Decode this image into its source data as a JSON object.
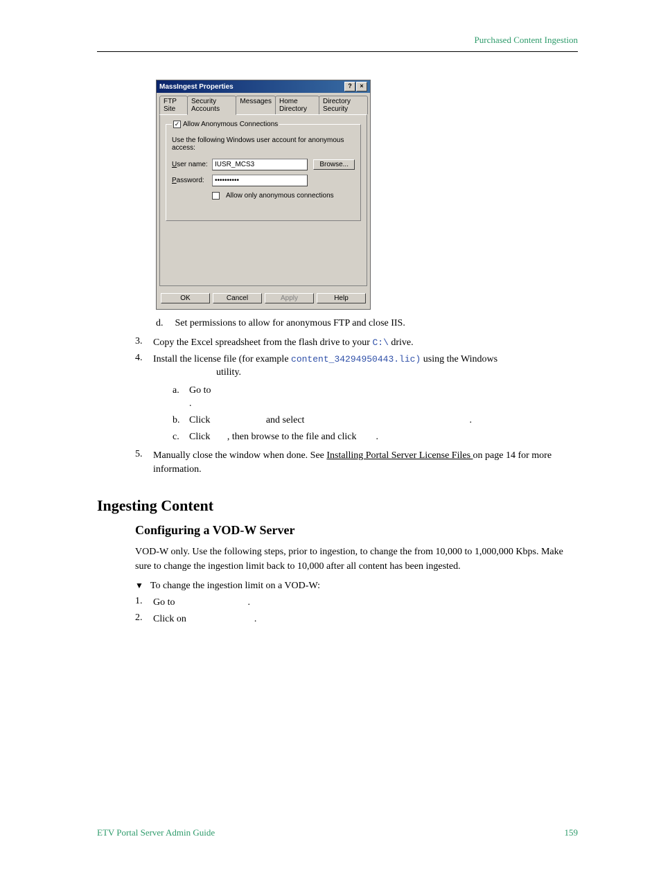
{
  "header": "Purchased Content Ingestion",
  "dialog": {
    "title": "MassIngest Properties",
    "tabs": [
      "FTP Site",
      "Security Accounts",
      "Messages",
      "Home Directory",
      "Directory Security"
    ],
    "activeTab": 1,
    "allowAnon": "Allow Anonymous Connections",
    "note": "Use the following Windows user account for anonymous access:",
    "usernameLabel": "User name:",
    "username": "IUSR_MCS3",
    "passwordLabel": "Password:",
    "password": "••••••••••",
    "browse": "Browse...",
    "allowOnly": "Allow only anonymous connections",
    "buttons": {
      "ok": "OK",
      "cancel": "Cancel",
      "apply": "Apply",
      "help": "Help"
    }
  },
  "stepD": {
    "label": "d.",
    "text": "Set permissions to allow for anonymous FTP and close IIS."
  },
  "step3": {
    "num": "3.",
    "pre": "Copy the Excel spreadsheet from the flash drive to your ",
    "code": "C:\\",
    "post": " drive."
  },
  "step4": {
    "num": "4.",
    "pre": "Install the license file (for example ",
    "code": "content_34294950443.lic)",
    "post": " using the Windows ",
    "tail": "utility.",
    "a": {
      "label": "a.",
      "text": "Go to ",
      "suffix": "."
    },
    "b": {
      "label": "b.",
      "pre": "Click ",
      "mid": " and select ",
      "post": "."
    },
    "c": {
      "label": "c.",
      "pre": "Click ",
      "mid": ", then browse to the file and click ",
      "post": "."
    }
  },
  "step5": {
    "num": "5.",
    "pre": "Manually close the window when done. See ",
    "link": "Installing Portal Server License Files ",
    "post": "on page 14 for more information."
  },
  "h2": "Ingesting Content",
  "h3": "Configuring a VOD-W Server",
  "para": "VOD-W only. Use the following steps, prior to ingestion, to change the                       from 10,000 to 1,000,000 Kbps. Make sure to change the ingestion limit back to 10,000 after all content has been ingested.",
  "proc": {
    "bullet": "▼",
    "text": "To change the ingestion limit on a VOD-W:"
  },
  "p1": {
    "num": "1.",
    "text": "Go to ",
    "post": "."
  },
  "p2": {
    "num": "2.",
    "text": "Click on ",
    "post": "."
  },
  "footer": {
    "left": "ETV Portal Server Admin Guide",
    "right": "159"
  }
}
